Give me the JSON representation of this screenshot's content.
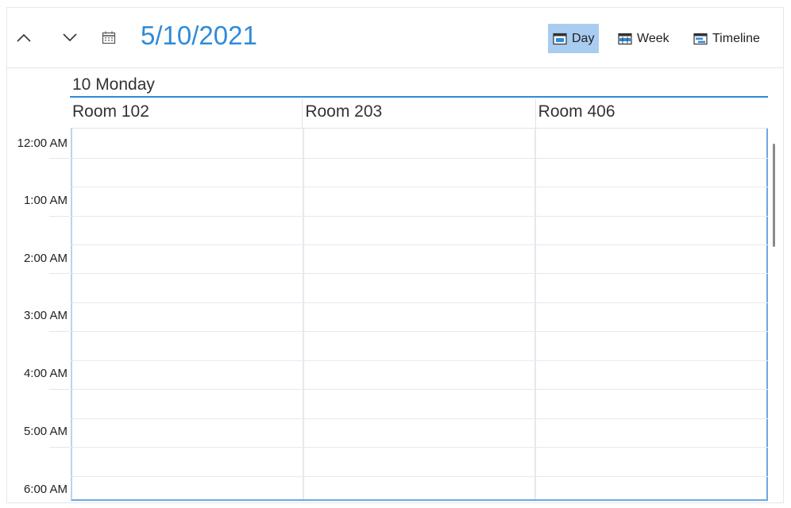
{
  "toolbar": {
    "current_date": "5/10/2021",
    "views": [
      {
        "label": "Day",
        "active": true,
        "icon": "day-view-icon"
      },
      {
        "label": "Week",
        "active": false,
        "icon": "week-view-icon"
      },
      {
        "label": "Timeline",
        "active": false,
        "icon": "timeline-view-icon"
      }
    ],
    "icons": {
      "previous": "chevron-up-icon",
      "next": "chevron-down-icon",
      "calendar": "calendar-icon"
    }
  },
  "day_header": {
    "label": "10 Monday"
  },
  "resources": [
    {
      "label": "Room 102"
    },
    {
      "label": "Room 203"
    },
    {
      "label": "Room 406"
    }
  ],
  "time_slots": [
    {
      "label": "12:00 AM"
    },
    {
      "label": "1:00 AM"
    },
    {
      "label": "2:00 AM"
    },
    {
      "label": "3:00 AM"
    },
    {
      "label": "4:00 AM"
    },
    {
      "label": "5:00 AM"
    },
    {
      "label": "6:00 AM"
    }
  ],
  "colors": {
    "accent": "#2f8bd8",
    "active_view_bg": "#a9cdf0",
    "grid_line": "#e6e9ee"
  }
}
